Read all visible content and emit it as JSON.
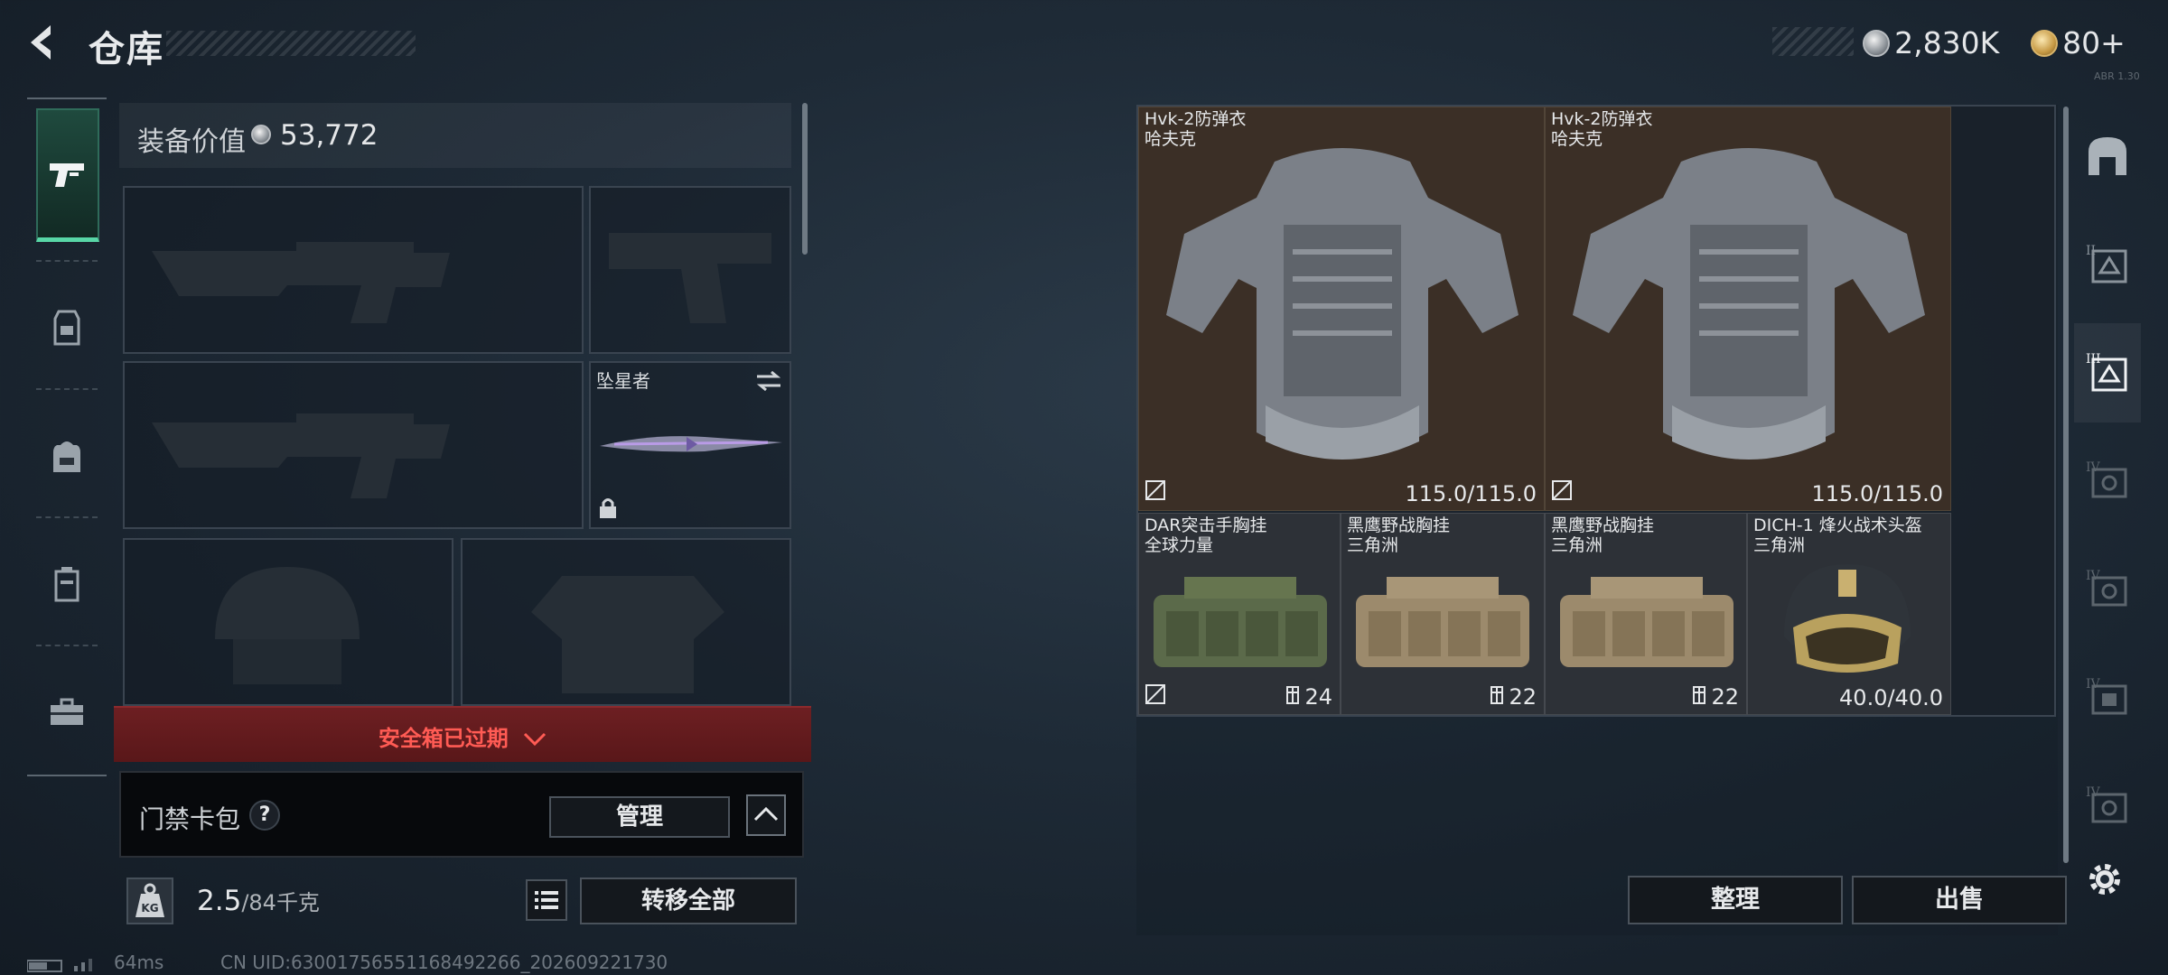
{
  "header": {
    "title": "仓库",
    "currencies": [
      {
        "icon": "silver-coin-icon",
        "amount": "2,830K"
      },
      {
        "icon": "gold-coin-icon",
        "amount": "80+"
      }
    ],
    "corner_tag": "ABR 1.30"
  },
  "left_nav": {
    "items": [
      {
        "icon": "gun-icon",
        "active": true
      },
      {
        "icon": "vest-icon",
        "active": false
      },
      {
        "icon": "backpack-icon",
        "active": false
      },
      {
        "icon": "case-icon",
        "active": false
      },
      {
        "icon": "briefcase-icon",
        "active": false
      }
    ]
  },
  "equipment": {
    "value_label": "装备价值",
    "value_amount": "53,772",
    "melee_name": "坠星者",
    "secure_case_status": "安全箱已过期",
    "card_pack_label": "门禁卡包",
    "help_symbol": "?",
    "manage_label": "管理",
    "weight_current": "2.5",
    "weight_max": "/84千克",
    "weight_icon_text": "KG",
    "transfer_all_label": "转移全部"
  },
  "status": {
    "ping": "64ms",
    "uid": "CN UID:6300175655116849226​6_202609221730"
  },
  "storage": {
    "items": [
      {
        "name": "Hvk-2防弹衣",
        "brand": "哈夫克",
        "durability": "115.0/115.0",
        "type": "armor"
      },
      {
        "name": "Hvk-2防弹衣",
        "brand": "哈夫克",
        "durability": "115.0/115.0",
        "type": "armor"
      },
      {
        "name": "DAR突击手胸挂",
        "brand": "全球力量",
        "capacity": "24",
        "type": "rig-green"
      },
      {
        "name": "黑鹰野战胸挂",
        "brand": "三角洲",
        "capacity": "22",
        "type": "rig-tan"
      },
      {
        "name": "黑鹰野战胸挂",
        "brand": "三角洲",
        "capacity": "22",
        "type": "rig-tan"
      },
      {
        "name": "DICH-1 烽火战术头盔",
        "brand": "三角洲",
        "durability": "40.0/40.0",
        "type": "helmet"
      }
    ],
    "sort_label": "整理",
    "sell_label": "出售",
    "side_tabs": [
      {
        "icon": "safe-room-icon",
        "label": ""
      },
      {
        "icon": "storage-tier-icon",
        "label": "II"
      },
      {
        "icon": "storage-tier-icon",
        "label": "III"
      },
      {
        "icon": "storage-tier-icon",
        "label": "IV"
      },
      {
        "icon": "storage-tier-icon",
        "label": "IV"
      },
      {
        "icon": "storage-tier-icon",
        "label": "IV"
      },
      {
        "icon": "storage-tier-icon",
        "label": "IV"
      }
    ]
  }
}
